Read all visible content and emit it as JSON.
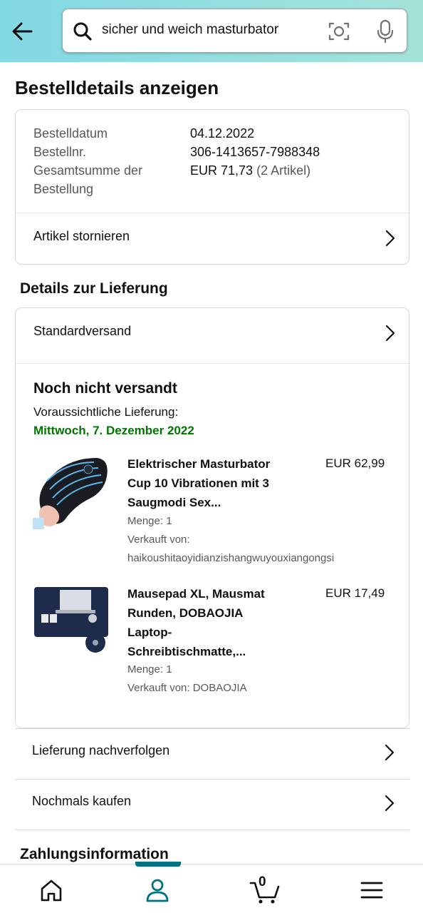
{
  "search": {
    "query": "sicher und weich masturbator"
  },
  "page": {
    "title": "Bestelldetails anzeigen"
  },
  "order_summary": {
    "date_label": "Bestelldatum",
    "date_value": "04.12.2022",
    "number_label": "Bestellnr.",
    "number_value": "306-1413657-7988348",
    "total_label_line1": "Gesamtsumme der",
    "total_label_line2": "Bestellung",
    "total_value": "EUR 71,73",
    "total_items": "(2 Artikel)",
    "cancel_label": "Artikel stornieren"
  },
  "delivery": {
    "section_title": "Details zur Lieferung",
    "shipping_method": "Standardversand",
    "status": "Noch nicht versandt",
    "eta_label": "Voraussichtliche Lieferung:",
    "eta_date": "Mittwoch, 7. Dezember 2022",
    "eta_color": "#007600",
    "items": [
      {
        "title_lines": [
          "Elektrischer Masturbator",
          "Cup 10 Vibrationen mit 3",
          "Saugmodi Sex..."
        ],
        "price": "EUR 62,99",
        "quantity": "Menge: 1",
        "seller_label": "Verkauft von:",
        "seller": "haikoushitaoyidianzishangwuyouxiangongsi"
      },
      {
        "title_lines": [
          "Mausepad XL, Mausmat",
          "Runden, DOBAOJIA",
          "Laptop-",
          "Schreibtischmatte,..."
        ],
        "price": "EUR 17,49",
        "quantity": "Menge: 1",
        "seller_label": "Verkauft von: DOBAOJIA"
      }
    ]
  },
  "actions": {
    "track": "Lieferung nachverfolgen",
    "buy_again": "Nochmals kaufen"
  },
  "payment": {
    "section_title": "Zahlungsinformation"
  },
  "bottom_nav": {
    "items": [
      "home-icon",
      "account-icon",
      "cart-icon",
      "menu-icon"
    ],
    "cart_count": "0",
    "active_color": "#007185"
  }
}
